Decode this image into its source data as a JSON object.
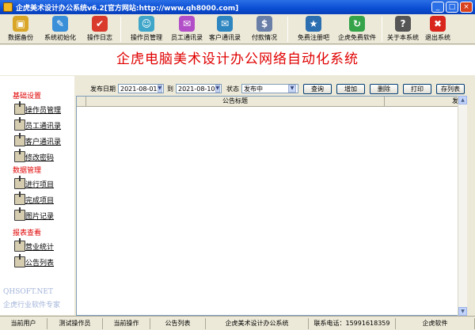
{
  "window": {
    "title": "企虎美术设计办公系统v6.2[官方网站:http://www.qh8000.com]",
    "buttons": {
      "minimize": "_",
      "maximize": "□",
      "close": "×"
    }
  },
  "toolbar": {
    "items": [
      {
        "label": "数据备份",
        "icon": "database-backup-icon",
        "color": "#d9a627",
        "glyph": "▣"
      },
      {
        "label": "系统初始化",
        "icon": "system-init-icon",
        "color": "#3a8fd9",
        "glyph": "✎"
      },
      {
        "label": "操作日志",
        "icon": "operation-log-icon",
        "color": "#d93a2b",
        "glyph": "✔"
      },
      {
        "label": "操作员管理",
        "icon": "operator-manage-icon",
        "color": "#3fa6c9",
        "glyph": "☺"
      },
      {
        "label": "员工通讯录",
        "icon": "employee-contacts-icon",
        "color": "#b24fc8",
        "glyph": "✉"
      },
      {
        "label": "客户通讯录",
        "icon": "customer-contacts-icon",
        "color": "#2e86c1",
        "glyph": "✉"
      },
      {
        "label": "付款情况",
        "icon": "payment-status-icon",
        "color": "#6a7fa8",
        "glyph": "$"
      },
      {
        "label": "免费注册吧",
        "icon": "free-register-icon",
        "color": "#2c6fb0",
        "glyph": "★"
      },
      {
        "label": "企虎免费软件",
        "icon": "free-software-icon",
        "color": "#35a34a",
        "glyph": "↻"
      },
      {
        "label": "关于本系统",
        "icon": "about-system-icon",
        "color": "#555555",
        "glyph": "?"
      },
      {
        "label": "退出系统",
        "icon": "exit-system-icon",
        "color": "#d9261c",
        "glyph": "✖"
      }
    ]
  },
  "banner": {
    "title": "企虎电脑美术设计办公网络自动化系统"
  },
  "sidebar": {
    "sections": [
      {
        "title": "基础设置",
        "items": [
          "操作员管理",
          "员工通讯录",
          "客户通讯录",
          "修改密码"
        ]
      },
      {
        "title": "数据管理",
        "items": [
          "进行项目",
          "完成项目",
          "图片记录"
        ]
      },
      {
        "title": "报表查看",
        "items": [
          "营业统计",
          "公告列表"
        ]
      }
    ],
    "watermark": {
      "line1": "QHSOFT.NET",
      "line2": "企虎行业软件专家"
    }
  },
  "filter": {
    "date_label": "发布日期",
    "date_from": "2021-08-01",
    "to_label": "到",
    "date_to": "2021-08-10",
    "status_label": "状态",
    "status_value": "发布中",
    "buttons": {
      "query": "查询",
      "add": "增加",
      "delete": "删除",
      "print": "打印",
      "save_as": "存列表"
    }
  },
  "grid": {
    "columns": [
      "公告标题",
      "发布"
    ]
  },
  "statusbar": {
    "cells": [
      "当前用户",
      "测试操作员",
      "当前操作",
      "公告列表",
      "企虎美术设计办公系统",
      "联系电话：15991618359",
      "企虎软件"
    ]
  }
}
